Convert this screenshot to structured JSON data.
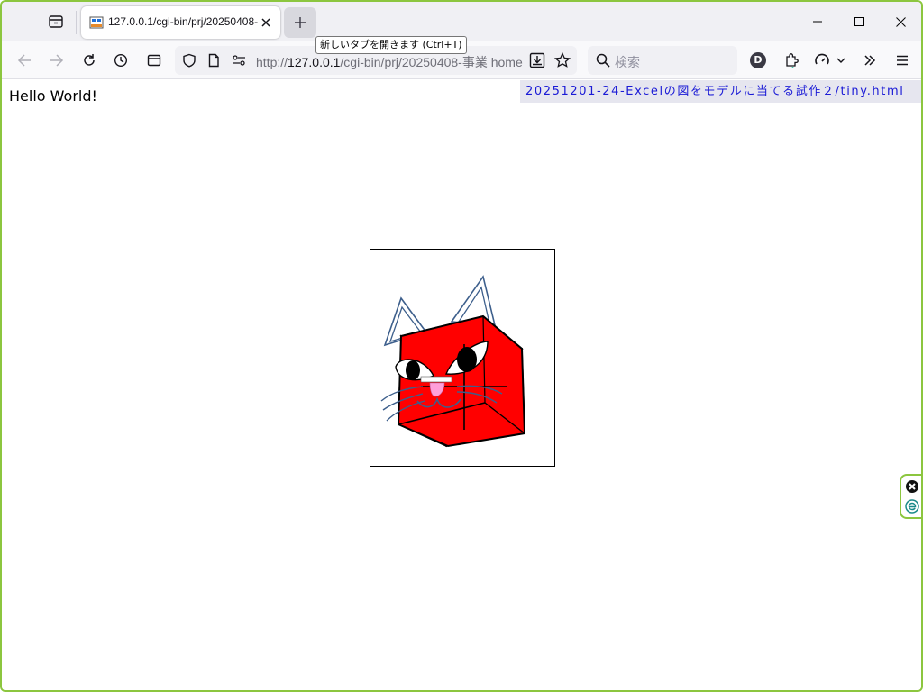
{
  "browser": {
    "tab": {
      "title": "127.0.0.1/cgi-bin/prj/20250408-"
    },
    "tooltip": "新しいタブを開きます (Ctrl+T)",
    "url": {
      "prefix": "http://",
      "host": "127.0.0.1",
      "path": "/cgi-bin/prj/20250408-事業 home"
    },
    "search": {
      "placeholder": "検索"
    },
    "account": {
      "initial": "D"
    },
    "colors": {
      "window_border": "#8cc63f",
      "tab_strip": "#f0f0f4"
    }
  },
  "page": {
    "greeting": "Hello World!",
    "file_banner": "20251201-24-Excelの図をモデルに当てる試作２/tiny.html",
    "drawing": {
      "subject": "red cube cat face",
      "colors": {
        "cube_fill": "#ff0000",
        "outline": "#000000",
        "ear_line": "#3d5f8c",
        "whisker_line": "#3d5f8c",
        "nose": "#ff9fd9"
      }
    }
  },
  "icons": [
    "tab-list-icon",
    "close-icon",
    "plus-icon",
    "minimize-icon",
    "maximize-icon",
    "back-icon",
    "forward-icon",
    "reload-icon",
    "history-icon",
    "sidebar-icon",
    "shield-icon",
    "page-icon",
    "permissions-icon",
    "download-icon",
    "star-icon",
    "search-icon",
    "extensions-icon",
    "performance-icon",
    "chevron-down-icon",
    "overflow-icon",
    "menu-icon"
  ]
}
